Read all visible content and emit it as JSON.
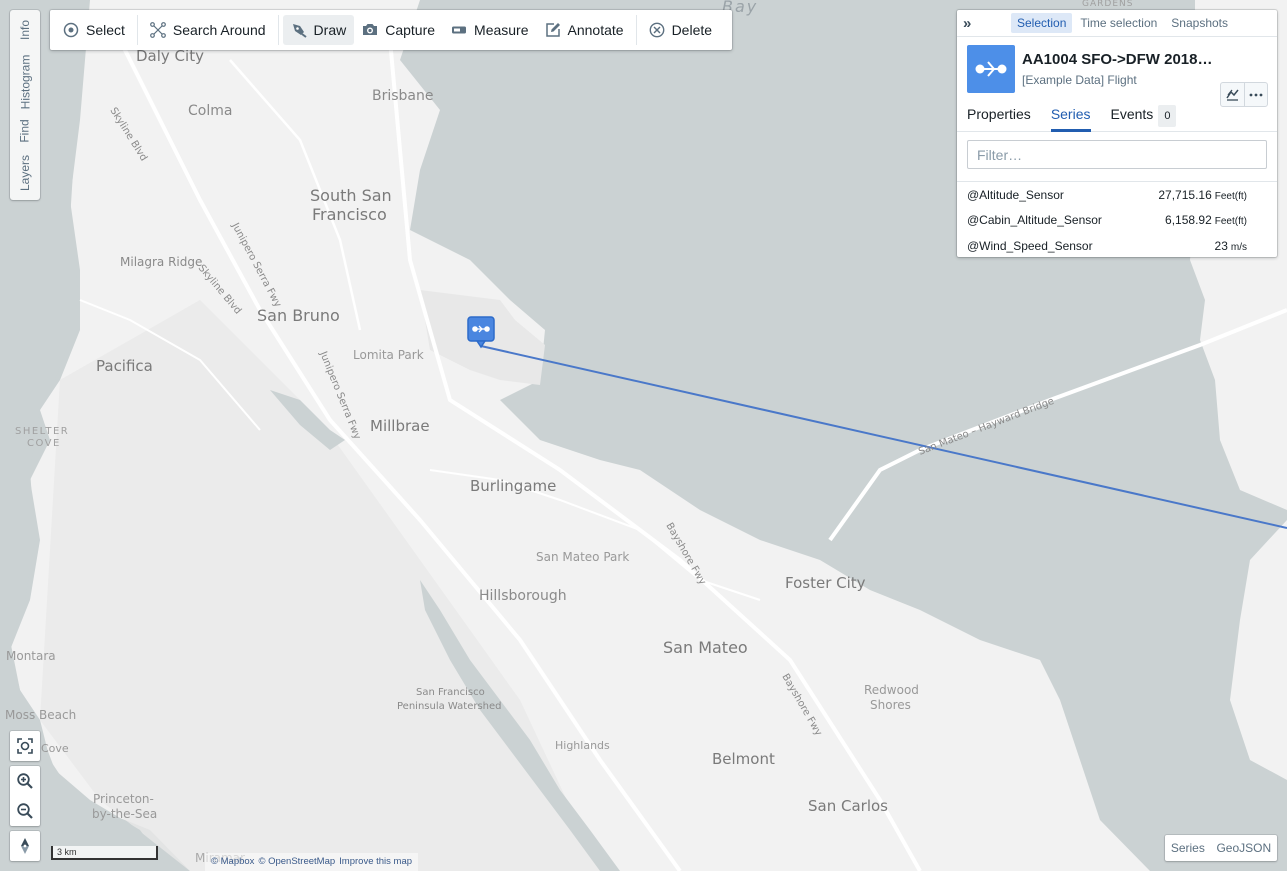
{
  "side_tabs": [
    "Info",
    "Histogram",
    "Find",
    "Layers"
  ],
  "toolbar": {
    "items": [
      {
        "label": "Select",
        "icon": "select-icon"
      },
      {
        "label": "Search Around",
        "icon": "search-around-icon"
      },
      {
        "label": "Draw",
        "icon": "draw-icon",
        "active": true
      },
      {
        "label": "Capture",
        "icon": "camera-icon"
      },
      {
        "label": "Measure",
        "icon": "measure-icon"
      },
      {
        "label": "Annotate",
        "icon": "annotate-icon"
      },
      {
        "label": "Delete",
        "icon": "delete-icon"
      }
    ]
  },
  "panel": {
    "tabs": [
      "Selection",
      "Time selection",
      "Snapshots"
    ],
    "active_tab": "Selection",
    "object": {
      "title": "AA1004 SFO->DFW 2018-0…",
      "subtitle": "[Example Data] Flight",
      "icon": "flight-path-icon",
      "icon_color": "#4d8fe8"
    },
    "sub_tabs": {
      "properties": "Properties",
      "series": "Series",
      "events": "Events",
      "events_count": "0"
    },
    "filter": {
      "placeholder": "Filter…",
      "value": ""
    },
    "series": [
      {
        "name": "@Altitude_Sensor",
        "value": "27,715.16",
        "unit": "Feet(ft)"
      },
      {
        "name": "@Cabin_Altitude_Sensor",
        "value": "6,158.92",
        "unit": "Feet(ft)"
      },
      {
        "name": "@Wind_Speed_Sensor",
        "value": "23",
        "unit": "m/s"
      }
    ]
  },
  "map": {
    "labels": {
      "bay": "Bay",
      "gardens": "GARDENS",
      "daly_city": "Daly City",
      "colma": "Colma",
      "brisbane": "Brisbane",
      "skyline_blvd": "Skyline Blvd",
      "south_sf_1": "South San",
      "south_sf_2": "Francisco",
      "milagra_ridge": "Milagra Ridge",
      "junipero_1": "Junipero Serra Fwy",
      "skyline_blvd_2": "Skyline Blvd",
      "san_bruno": "San Bruno",
      "lomita_park": "Lomita Park",
      "pacifica": "Pacifica",
      "junipero_2": "Junipero Serra Fwy",
      "millbrae": "Millbrae",
      "shelter": "SHELTER",
      "cove": "COVE",
      "burlingame": "Burlingame",
      "bridge": "San Mateo – Hayward Bridge",
      "bayshore_1": "Bayshore Fwy",
      "san_mateo_park": "San Mateo Park",
      "foster_city": "Foster City",
      "hillsborough": "Hillsborough",
      "san_mateo": "San Mateo",
      "montara": "Montara",
      "bayshore_2": "Bayshore Fwy",
      "redwood": "Redwood",
      "shores": "Shores",
      "sfpw_1": "San Francisco",
      "sfpw_2": "Peninsula Watershed",
      "moss_beach": "Moss Beach",
      "cove2": "Cove",
      "highlands": "Highlands",
      "belmont": "Belmont",
      "princeton_1": "Princeton-",
      "princeton_2": "by-the-Sea",
      "san_carlos": "San Carlos",
      "miramar": "Miramar"
    },
    "route_color": "#4a78c9",
    "scale_label": "3 km",
    "attribution": [
      "© Mapbox",
      "© OpenStreetMap",
      "Improve this map"
    ]
  },
  "export": {
    "series": "Series",
    "geojson": "GeoJSON"
  }
}
